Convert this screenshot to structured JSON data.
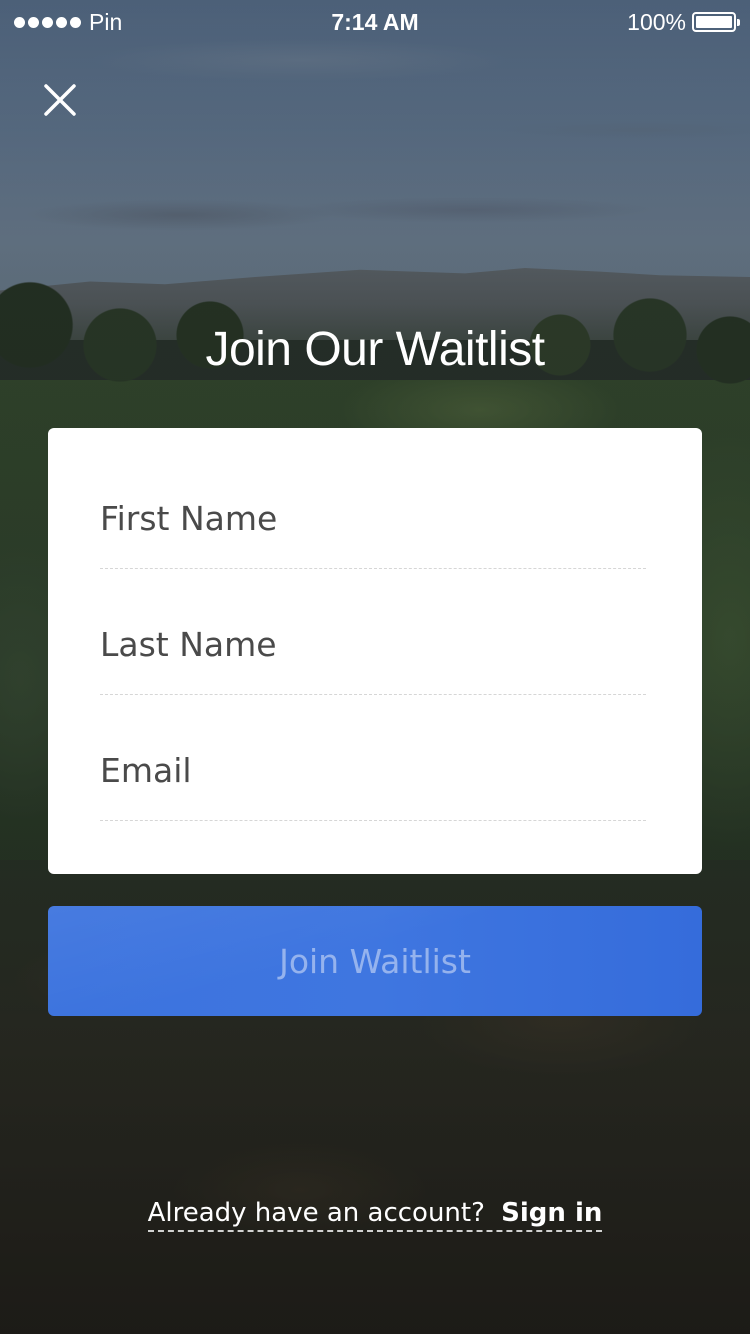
{
  "status_bar": {
    "carrier": "Pin",
    "time": "7:14 AM",
    "battery": "100%",
    "battery_level": 1.0,
    "signal_bars": 5
  },
  "close": {
    "icon": "close-icon"
  },
  "title": "Join Our Waitlist",
  "form": {
    "first_name": {
      "placeholder": "First Name",
      "value": ""
    },
    "last_name": {
      "placeholder": "Last Name",
      "value": ""
    },
    "email": {
      "placeholder": "Email",
      "value": ""
    }
  },
  "submit": {
    "label": "Join Waitlist",
    "color": "#3c73de"
  },
  "footer": {
    "prompt": "Already have an account?",
    "action": "Sign in"
  }
}
